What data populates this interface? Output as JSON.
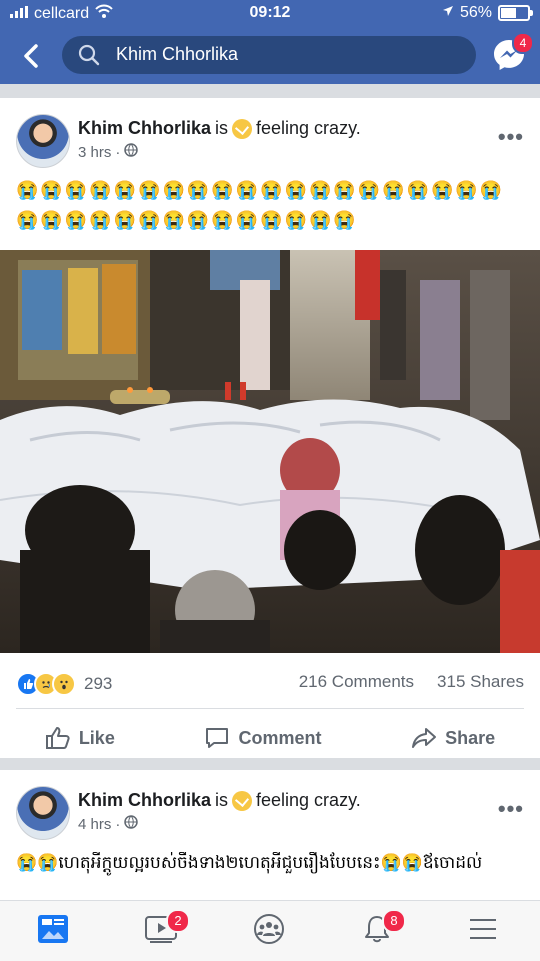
{
  "status": {
    "carrier": "cellcard",
    "time": "09:12",
    "battery": "56%",
    "battery_level": 0.56
  },
  "nav": {
    "search_text": "Khim Chhorlika",
    "messenger_badge": "4"
  },
  "post1": {
    "author": "Khim Chhorlika",
    "is": "is",
    "feeling": "feeling crazy.",
    "time": "3 hrs",
    "sep": "·",
    "more": "•••",
    "body_line1": "😭😭😭😭😭😭😭😭😭😭😭😭😭😭😭😭😭😭😭😭",
    "body_line2": "😭😭😭😭😭😭😭😭😭😭😭😭😭😭",
    "reaction_count": "293",
    "comments": "216 Comments",
    "shares": "315 Shares",
    "like_label": "Like",
    "comment_label": "Comment",
    "share_label": "Share"
  },
  "post2": {
    "author": "Khim Chhorlika",
    "is": "is",
    "feeling": "feeling crazy.",
    "time": "4 hrs",
    "sep": "·",
    "more": "•••",
    "body_line1": "😭😭ហេតុអីក្តូយល្អរបស់ចឹងទាង២ហេតុអីជួបរឿងបែបនេះ😭😭ឪចោដល់"
  },
  "tabbar": {
    "video_badge": "2",
    "notif_badge": "8"
  }
}
